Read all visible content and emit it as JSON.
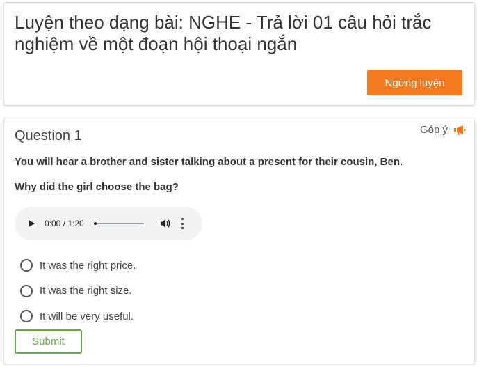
{
  "header": {
    "title": "Luyện theo dạng bài: NGHE - Trả lời 01 câu hỏi trắc nghiệm về một đoạn hội thoại ngắn",
    "stop_button_label": "Ngừng luyện"
  },
  "question": {
    "title": "Question 1",
    "feedback_label": "Góp ý",
    "prompt_1": "You will hear a brother and sister talking about a present for their cousin, Ben.",
    "prompt_2": "Why did the girl choose the bag?",
    "audio": {
      "time": "0:00 / 1:20",
      "progress": 0
    },
    "options": [
      {
        "label": "It was the right price."
      },
      {
        "label": "It was the right size."
      },
      {
        "label": "It will be very useful."
      }
    ],
    "submit_label": "Submit"
  },
  "colors": {
    "accent_orange": "#f47a20",
    "submit_green": "#6aa84f"
  },
  "icons": [
    "megaphone-icon",
    "play-icon",
    "volume-icon",
    "more-options-icon"
  ]
}
